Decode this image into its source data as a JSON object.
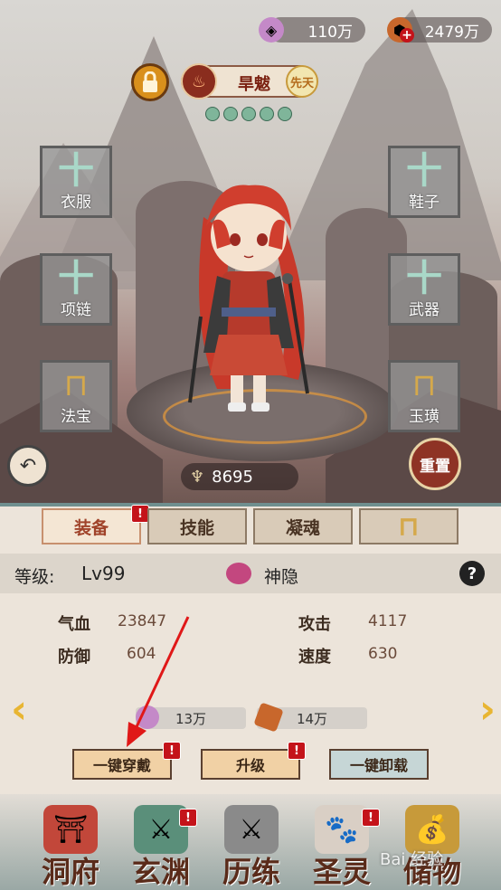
{
  "currency": {
    "jade": "110万",
    "gold": "2479万",
    "gold_plus": "+"
  },
  "hero": {
    "name": "旱魃",
    "badge": "先天"
  },
  "equip_slots": {
    "clothes": "衣服",
    "shoes": "鞋子",
    "necklace": "项链",
    "weapon": "武器",
    "treasure": "法宝",
    "jade": "玉璜"
  },
  "power": "8695",
  "reset_label": "重置",
  "tabs": {
    "equip": "装备",
    "skill": "技能",
    "soul": "凝魂"
  },
  "level": {
    "label": "等级:",
    "value": "Lv99",
    "rank": "神隐",
    "help": "?"
  },
  "stats": {
    "hp_label": "气血",
    "hp": "23847",
    "atk_label": "攻击",
    "atk": "4117",
    "def_label": "防御",
    "def": "604",
    "spd_label": "速度",
    "spd": "630"
  },
  "costs": {
    "jade": "13万",
    "ore": "14万"
  },
  "buttons": {
    "equip_all": "一键穿戴",
    "upgrade": "升级",
    "unequip_all": "一键卸载"
  },
  "badges": {
    "alert": "!"
  },
  "nav": {
    "mansion": "洞府",
    "xuanyuan": "玄渊",
    "trial": "历练",
    "spirit": "圣灵",
    "treasure": "储物"
  },
  "watermark": "Bai 经验",
  "colors": {
    "accent": "#a0432a",
    "alert": "#c4131a",
    "arrow": "#e8b532"
  }
}
